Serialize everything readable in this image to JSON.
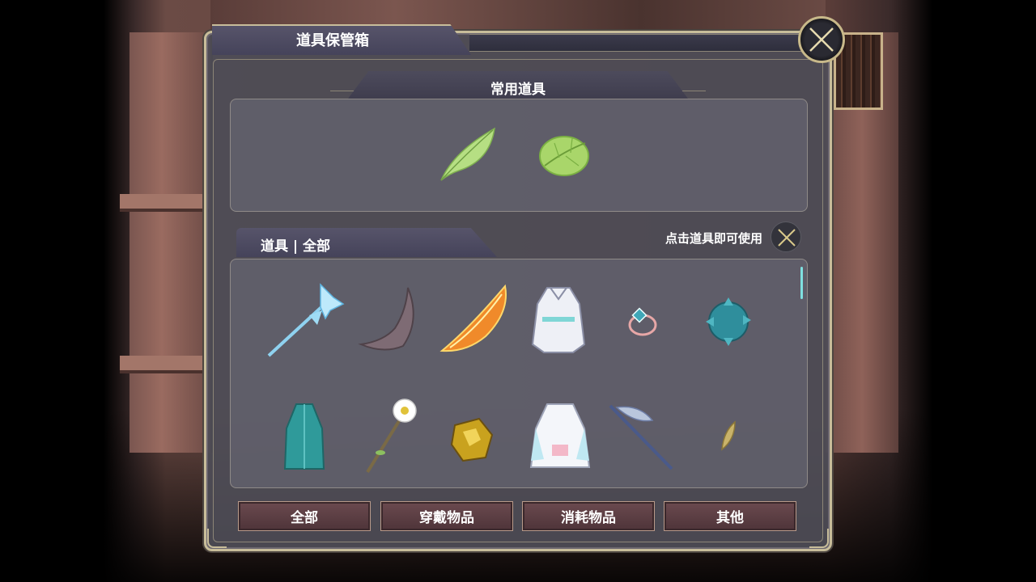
{
  "dialog": {
    "title": "道具保管箱",
    "close_icon": "close-x-icon"
  },
  "favorites": {
    "header": "常用道具",
    "items": [
      {
        "name": "green-leaf-feather-icon"
      },
      {
        "name": "green-round-leaf-icon"
      }
    ]
  },
  "inventory": {
    "tab_label": "道具 | 全部",
    "hint": "点击道具即可使用",
    "hint_icon": "crossed-swords-icon",
    "items": [
      {
        "name": "ice-crystal-staff-icon"
      },
      {
        "name": "dark-horn-icon"
      },
      {
        "name": "flame-blade-icon"
      },
      {
        "name": "white-robe-icon"
      },
      {
        "name": "gem-ring-icon"
      },
      {
        "name": "teal-spiked-orb-icon"
      },
      {
        "name": "teal-cloak-icon"
      },
      {
        "name": "white-flower-staff-icon"
      },
      {
        "name": "gold-ore-icon"
      },
      {
        "name": "white-dress-icon"
      },
      {
        "name": "steel-glaive-icon"
      },
      {
        "name": "small-golden-leaf-icon"
      }
    ]
  },
  "filters": {
    "all": "全部",
    "equipment": "穿戴物品",
    "consumables": "消耗物品",
    "other": "其他"
  },
  "colors": {
    "frame_gold": "#c8bd9a",
    "panel_bg": "#4e4c56",
    "button_bg": "#5c3f45",
    "accent_teal": "#7fe0e0"
  }
}
